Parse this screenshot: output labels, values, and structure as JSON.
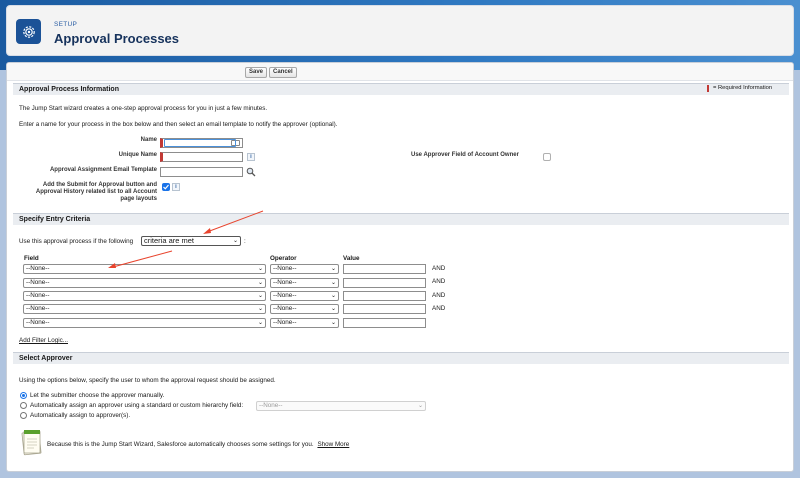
{
  "header": {
    "eyebrow": "SETUP",
    "title": "Approval Processes"
  },
  "toolbar": {
    "save_label": "Save",
    "cancel_label": "Cancel"
  },
  "section_info": {
    "title": "Approval Process Information",
    "required_legend": "= Required Information",
    "intro1": "The Jump Start wizard creates a one-step approval process for you in just a few minutes.",
    "intro2": "Enter a name for your process in the box below and then select an email template to notify the approver (optional).",
    "name_label": "Name",
    "name_value": "",
    "unique_name_label": "Unique Name",
    "unique_name_value": "",
    "email_template_label": "Approval Assignment Email Template",
    "email_template_value": "",
    "submit_label_line1": "Add the Submit for Approval button and",
    "submit_label_line2": "Approval History related list to all Account",
    "submit_label_line3": "page layouts",
    "submit_checked": true,
    "use_approver_label": "Use Approver Field of Account Owner",
    "use_approver_checked": false,
    "info_glyph": "i"
  },
  "section_criteria": {
    "title": "Specify Entry Criteria",
    "prompt": "Use this approval process if the following",
    "criteria_selected": "criteria are met",
    "colon": ":",
    "field_header": "Field",
    "operator_header": "Operator",
    "value_header": "Value",
    "and_label": "AND",
    "rows": [
      {
        "field": "--None--",
        "operator": "--None--",
        "value": ""
      },
      {
        "field": "--None--",
        "operator": "--None--",
        "value": ""
      },
      {
        "field": "--None--",
        "operator": "--None--",
        "value": ""
      },
      {
        "field": "--None--",
        "operator": "--None--",
        "value": ""
      },
      {
        "field": "--None--",
        "operator": "--None--",
        "value": ""
      }
    ],
    "add_filter_logic": "Add Filter Logic..."
  },
  "section_approver": {
    "title": "Select Approver",
    "intro": "Using the options below, specify the user to whom the approval request should be assigned.",
    "option_manual": "Let the submitter choose the approver manually.",
    "option_hierarchy": "Automatically assign an approver using a standard or custom hierarchy field:",
    "hierarchy_selected": "--None--",
    "option_assign": "Automatically assign to approver(s).",
    "selected_option": "manual",
    "note": "Because this is the Jump Start Wizard, Salesforce automatically chooses some settings for you.",
    "show_more": "Show More"
  },
  "colors": {
    "brand": "#1b5297",
    "required": "#c23934",
    "arrow": "#e8442d",
    "checkbox": "#1a73e8"
  },
  "icons": {
    "header": "gear-icon",
    "note": "notepad-icon",
    "lookup": "lookup-icon",
    "magnifier": "search-icon",
    "dropdown": "chevron-down-icon"
  }
}
